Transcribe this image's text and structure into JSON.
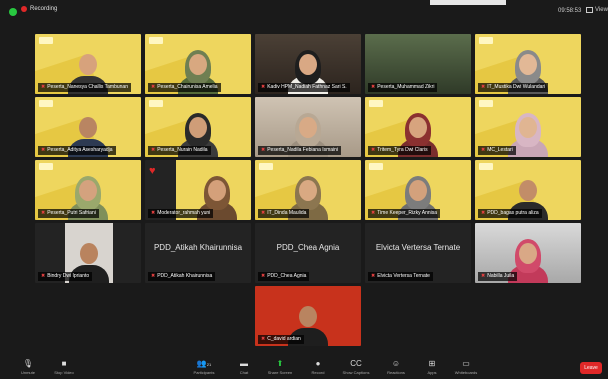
{
  "topbar": {
    "recording_label": "Recording",
    "clock": "09:58:53",
    "view_label": "View"
  },
  "tiles": [
    {
      "name": "Peserta_Nanesya Challis Tambunan"
    },
    {
      "name": "Peserta_Chairunisa Amelia"
    },
    {
      "name": "Kadiv HPM_Nadiah Fathnaz Sari S."
    },
    {
      "name": "Peserta_Muhammad Zikri"
    },
    {
      "name": "IT_Mustika Dwi Wulandari"
    },
    {
      "name": "Peserta_Aditya Asesharyadja"
    },
    {
      "name": "Peserta_Nurain Nadila"
    },
    {
      "name": "Peserta_Nadila Febiana Ismaini"
    },
    {
      "name": "Tritem_Tyra Dwi Claris"
    },
    {
      "name": "MC_Lestari"
    },
    {
      "name": "Peserta_Putri Safriani"
    },
    {
      "name": "Moderator_rahmah yuni"
    },
    {
      "name": "IT_Dinda Maulida"
    },
    {
      "name": "Time Keeper_Rizky Annisa"
    },
    {
      "name": "PDD_bagas putra aliza"
    },
    {
      "name": "Bindry Dwi Iprianto"
    },
    {
      "name": "PDD_Atikah Khairunnisa",
      "big": "PDD_Atikah Khairunnisa"
    },
    {
      "name": "PDD_Chea Agnia",
      "big": "PDD_Chea Agnia"
    },
    {
      "name": "Elvicta Vertersa Ternate",
      "big": "Elvicta Vertersa Ternate"
    },
    {
      "name": "Nabilla Juila"
    },
    {
      "name": "C_david ardian"
    }
  ],
  "toolbar": {
    "unmute": "Unmute",
    "stop_video": "Stop Video",
    "participants": "Participants",
    "participants_count": "21",
    "chat": "Chat",
    "share_screen": "Share Screen",
    "record": "Record",
    "show_captions": "Show Captions",
    "reactions": "Reactions",
    "apps": "Apps",
    "whiteboards": "Whiteboards",
    "leave": "Leave"
  }
}
